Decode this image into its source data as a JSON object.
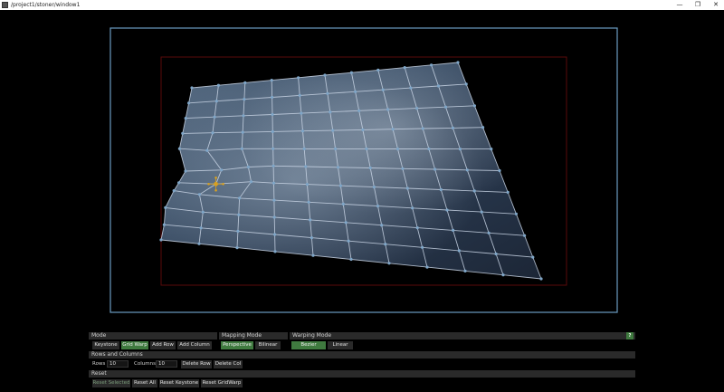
{
  "window": {
    "title": "/project1/stoner/window1",
    "minimize_glyph": "—",
    "maximize_glyph": "❐",
    "close_glyph": "✕"
  },
  "viewport": {
    "outer_frame_color": "#6a9bc0",
    "inner_frame_color": "#5a0a0a",
    "grid_line_color": "#c8d4e4",
    "grid_point_color": "#7fa6c8",
    "selected_point_color": "#d8a020",
    "image_sky_color": "#3b4f66"
  },
  "panel": {
    "mode": {
      "header": "Mode",
      "buttons": [
        "Keystone",
        "Grid Warp",
        "Add Row",
        "Add Column"
      ],
      "active": "Grid Warp"
    },
    "mapping_mode": {
      "header": "Mapping Mode",
      "buttons": [
        "Perspective",
        "Bilinear"
      ],
      "active": "Perspective"
    },
    "warping_mode": {
      "header": "Warping Mode",
      "buttons": [
        "Bezier",
        "Linear"
      ],
      "active": "Bezier",
      "help": "?"
    },
    "rows_columns": {
      "header": "Rows and Columns",
      "rows_label": "Rows",
      "rows_value": "10",
      "columns_label": "Columns",
      "columns_value": "10",
      "delete_row": "Delete Row",
      "delete_col": "Delete Col"
    },
    "reset": {
      "header": "Reset",
      "buttons": [
        "Reset Selected",
        "Reset All",
        "Reset Keystone",
        "Reset GridWarp"
      ]
    }
  }
}
